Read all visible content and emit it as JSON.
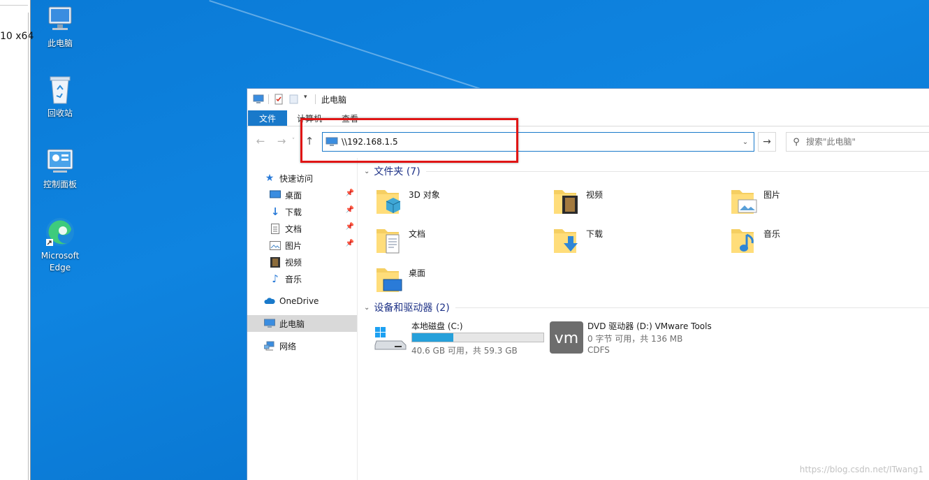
{
  "left_window": {
    "text": "10 x64"
  },
  "desktop": {
    "icons": [
      {
        "label": "此电脑"
      },
      {
        "label": "回收站"
      },
      {
        "label": "控制面板"
      },
      {
        "label": "Microsoft Edge"
      }
    ]
  },
  "explorer": {
    "title": "此电脑",
    "ribbon_tabs": [
      "文件",
      "计算机",
      "查看"
    ],
    "address": "\\\\192.168.1.5",
    "search_placeholder": "搜索\"此电脑\"",
    "nav": {
      "quick_access": "快速访问",
      "items": [
        "桌面",
        "下载",
        "文档",
        "图片",
        "视频",
        "音乐"
      ],
      "onedrive": "OneDrive",
      "this_pc": "此电脑",
      "network": "网络"
    },
    "folders_header": "文件夹 (7)",
    "folders": [
      "3D 对象",
      "视频",
      "图片",
      "文档",
      "下载",
      "音乐",
      "桌面"
    ],
    "devices_header": "设备和驱动器 (2)",
    "drives": [
      {
        "name": "本地磁盘 (C:)",
        "detail": "40.6 GB 可用，共 59.3 GB",
        "used_fraction": 0.315
      },
      {
        "name": "DVD 驱动器 (D:) VMware Tools",
        "detail": "0 字节 可用，共 136 MB",
        "fs": "CDFS"
      }
    ]
  },
  "watermark": "https://blog.csdn.net/ITwang1",
  "colors": {
    "accent": "#1979ca",
    "highlight": "#e01515",
    "desktop": "#0a7ad6"
  }
}
